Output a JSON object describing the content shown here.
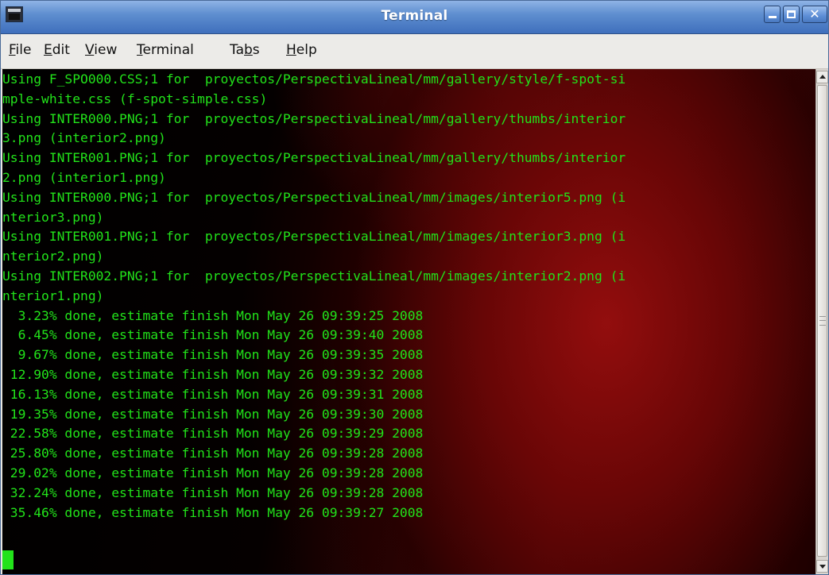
{
  "window": {
    "title": "Terminal",
    "icon": "terminal-app-icon",
    "controls": {
      "minimize": "minimize-icon",
      "maximize": "maximize-icon",
      "close": "close-icon"
    }
  },
  "menubar": {
    "items": [
      {
        "pre": "",
        "mnemonic": "F",
        "post": "ile"
      },
      {
        "pre": "",
        "mnemonic": "E",
        "post": "dit"
      },
      {
        "pre": "",
        "mnemonic": "V",
        "post": "iew"
      },
      {
        "pre": "",
        "mnemonic": "T",
        "post": "erminal"
      },
      {
        "pre": "Ta",
        "mnemonic": "b",
        "post": "s"
      },
      {
        "pre": "",
        "mnemonic": "H",
        "post": "elp"
      }
    ]
  },
  "terminal": {
    "text_color": "#22e31a",
    "lines": [
      "Using F_SPO000.CSS;1 for  proyectos/PerspectivaLineal/mm/gallery/style/f-spot-si",
      "mple-white.css (f-spot-simple.css)",
      "Using INTER000.PNG;1 for  proyectos/PerspectivaLineal/mm/gallery/thumbs/interior",
      "3.png (interior2.png)",
      "Using INTER001.PNG;1 for  proyectos/PerspectivaLineal/mm/gallery/thumbs/interior",
      "2.png (interior1.png)",
      "Using INTER000.PNG;1 for  proyectos/PerspectivaLineal/mm/images/interior5.png (i",
      "nterior3.png)",
      "Using INTER001.PNG;1 for  proyectos/PerspectivaLineal/mm/images/interior3.png (i",
      "nterior2.png)",
      "Using INTER002.PNG;1 for  proyectos/PerspectivaLineal/mm/images/interior2.png (i",
      "nterior1.png)",
      "  3.23% done, estimate finish Mon May 26 09:39:25 2008",
      "  6.45% done, estimate finish Mon May 26 09:39:40 2008",
      "  9.67% done, estimate finish Mon May 26 09:39:35 2008",
      " 12.90% done, estimate finish Mon May 26 09:39:32 2008",
      " 16.13% done, estimate finish Mon May 26 09:39:31 2008",
      " 19.35% done, estimate finish Mon May 26 09:39:30 2008",
      " 22.58% done, estimate finish Mon May 26 09:39:29 2008",
      " 25.80% done, estimate finish Mon May 26 09:39:28 2008",
      " 29.02% done, estimate finish Mon May 26 09:39:28 2008",
      " 32.24% done, estimate finish Mon May 26 09:39:28 2008",
      " 35.46% done, estimate finish Mon May 26 09:39:27 2008"
    ]
  }
}
